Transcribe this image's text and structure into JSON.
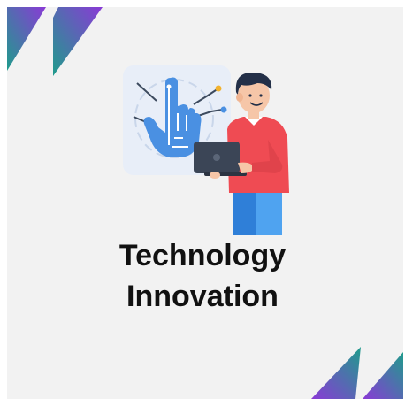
{
  "title": {
    "line1": "Technology",
    "line2": "Innovation"
  },
  "colors": {
    "background": "#f2f2f2",
    "corner_gradient_start": "#1f9c8c",
    "corner_gradient_end": "#8a3ad6",
    "shirt": "#ef4b53",
    "pants": "#4fa3f0",
    "hand_icon": "#4a90e2"
  },
  "icons": [
    "corner-decoration-top-left",
    "corner-decoration-bottom-right",
    "person-with-laptop-illustration",
    "touch-hand-circuit-icon"
  ]
}
